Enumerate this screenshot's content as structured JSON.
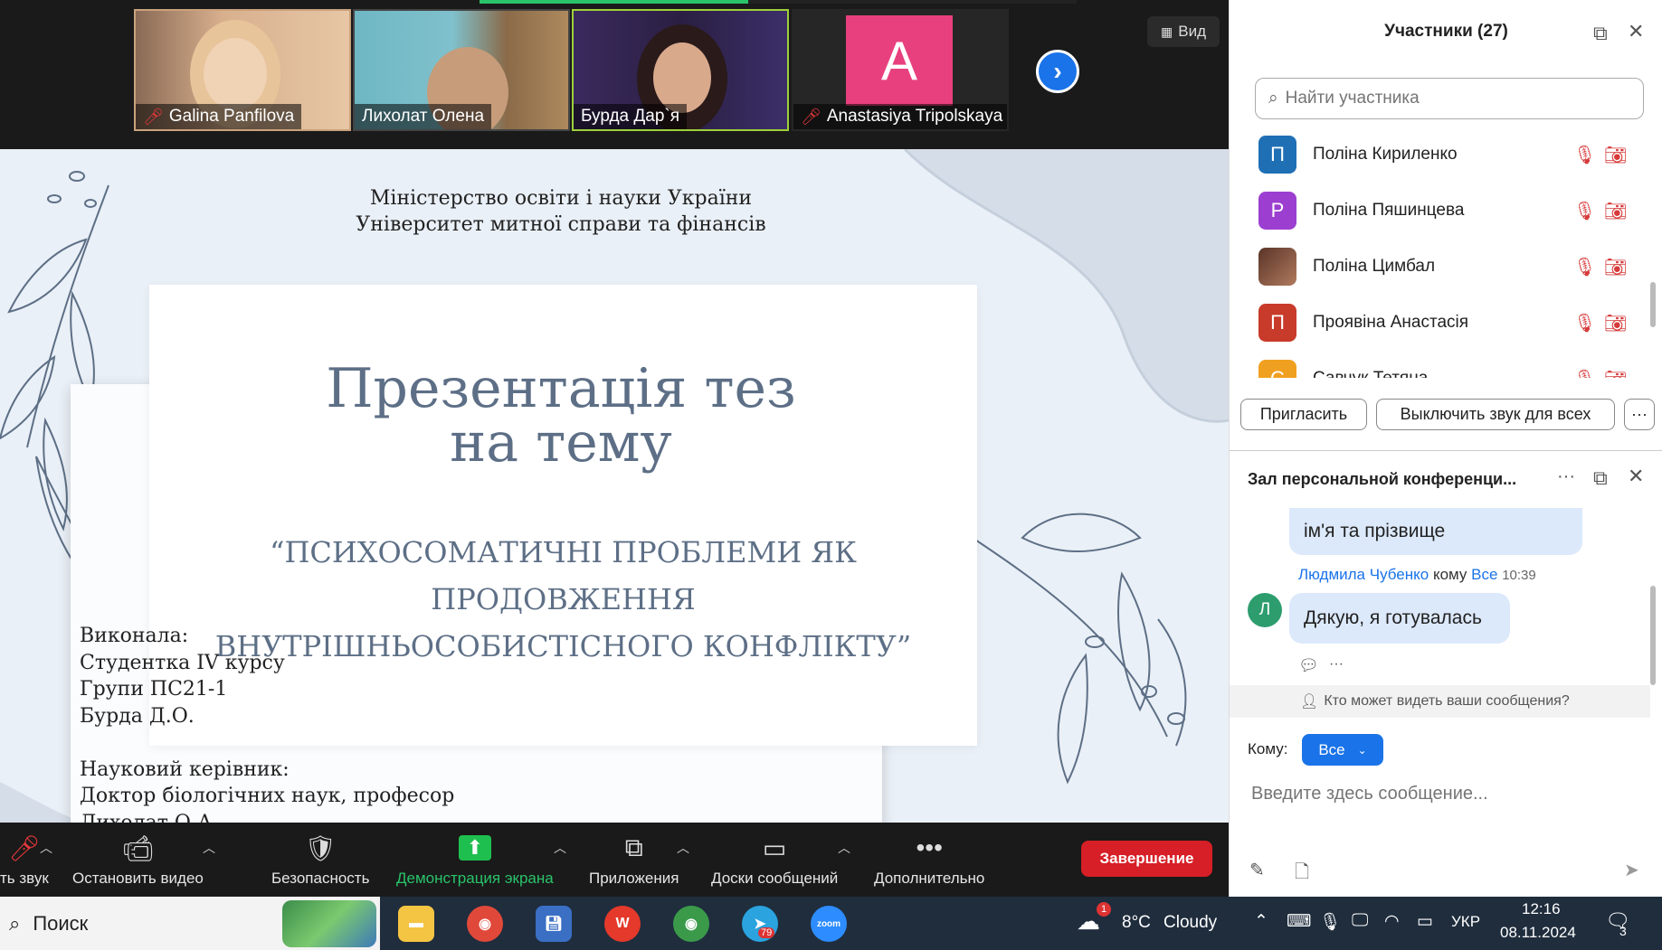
{
  "gallery": {
    "participants": [
      {
        "name": "Galina Panfilova",
        "muted": true
      },
      {
        "name": "Лихолат Олена",
        "muted": false
      },
      {
        "name": "Бурда Дар`я",
        "muted": false,
        "active": true
      },
      {
        "name": "Anastasiya Tripolskaya",
        "muted": true,
        "initial": "A"
      }
    ],
    "view_label": "Вид"
  },
  "slide": {
    "header_line1": "Міністерство освіти і науки України",
    "header_line2": "Університет митної справи та фінансів",
    "title_line1": "Презентація тез",
    "title_line2": "на тему",
    "topic_line1": "“ПСИХОСОМАТИЧНІ ПРОБЛЕМИ ЯК ПРОДОВЖЕННЯ",
    "topic_line2": "ВНУТРІШНЬОСОБИСТІСНОГО КОНФЛІКТУ”",
    "author": [
      "Виконала:",
      "Студентка IV курсу",
      "Групи ПС21-1",
      "Бурда Д.О.",
      "",
      "Науковий керівник:",
      "Доктор біологічних наук, професор",
      "Лихолат О.А."
    ]
  },
  "toolbar": {
    "audio": "ть звук",
    "video": "Остановить видео",
    "security": "Безопасность",
    "share": "Демонстрация экрана",
    "apps": "Приложения",
    "boards": "Доски сообщений",
    "more": "Дополнительно",
    "end": "Завершение"
  },
  "participants_panel": {
    "title": "Участники (27)",
    "search_placeholder": "Найти участника",
    "list": [
      {
        "name": "Поліна Кириленко",
        "initial": "П",
        "color": "#1f6fb5"
      },
      {
        "name": "Поліна Пяшинцева",
        "initial": "Р",
        "color": "#9c3fd0"
      },
      {
        "name": "Поліна Цимбал",
        "initial": "",
        "color": "#7a4a3a"
      },
      {
        "name": "Проявіна Анастасія",
        "initial": "П",
        "color": "#c83a2a"
      },
      {
        "name": "Савчук Тетяна",
        "initial": "С",
        "color": "#f0a020"
      }
    ],
    "invite": "Пригласить",
    "mute_all": "Выключить звук для всех",
    "more": "···"
  },
  "chat": {
    "title": "Зал персональной конференци...",
    "prev_message": "ім'я та прізвище",
    "author": "Людмила Чубенко",
    "to_word": "кому",
    "recipient": "Все",
    "time": "10:39",
    "avatar_initial": "Л",
    "message": "Дякую, я готувалась",
    "reply_more": "···",
    "who_sees": "Кто может видеть ваши сообщения?",
    "to_label": "Кому:",
    "to_value": "Все",
    "input_placeholder": "Введите здесь сообщение..."
  },
  "taskbar": {
    "search": "Поиск",
    "weather_temp": "8°C",
    "weather_text": "Cloudy",
    "weather_badge": "1",
    "lang": "УКР",
    "time": "12:16",
    "date": "08.11.2024",
    "notif_count": "3",
    "telegram_badge": "79"
  }
}
